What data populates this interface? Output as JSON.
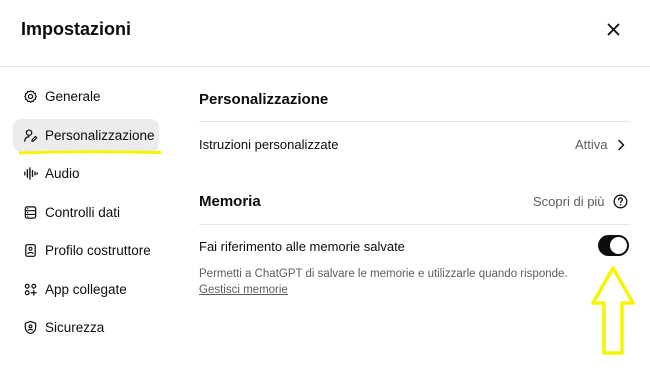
{
  "header": {
    "title": "Impostazioni",
    "close_icon": "close-icon"
  },
  "sidebar": {
    "items": [
      {
        "label": "Generale",
        "icon": "gear-icon",
        "active": false
      },
      {
        "label": "Personalizzazione",
        "icon": "user-edit-icon",
        "active": true
      },
      {
        "label": "Audio",
        "icon": "waveform-icon",
        "active": false
      },
      {
        "label": "Controlli dati",
        "icon": "database-icon",
        "active": false
      },
      {
        "label": "Profilo costruttore",
        "icon": "id-card-icon",
        "active": false
      },
      {
        "label": "App collegate",
        "icon": "apps-icon",
        "active": false
      },
      {
        "label": "Sicurezza",
        "icon": "shield-icon",
        "active": false
      }
    ]
  },
  "main": {
    "personalization": {
      "title": "Personalizzazione",
      "custom_instructions": {
        "label": "Istruzioni personalizzate",
        "value": "Attiva"
      }
    },
    "memory": {
      "title": "Memoria",
      "learn_more": "Scopri di più",
      "saved_memories": {
        "label": "Fai riferimento alle memorie salvate",
        "enabled": true,
        "description": "Permetti a ChatGPT di salvare le memorie e utilizzarle quando risponde.",
        "manage_link": "Gestisci memorie"
      }
    }
  },
  "annotations": {
    "highlight_color": "#f5f500"
  }
}
